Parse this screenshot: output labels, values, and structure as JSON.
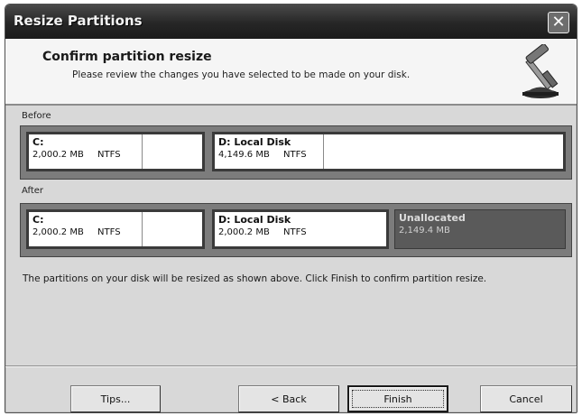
{
  "window": {
    "title": "Resize Partitions",
    "close_glyph": "✕"
  },
  "header": {
    "title": "Confirm partition resize",
    "subtitle": "Please review the changes you have selected to be made on your disk.",
    "icon": "hammer-on-disk-icon"
  },
  "before": {
    "label": "Before",
    "partitions": [
      {
        "name": "C:",
        "size": "2,000.2 MB",
        "fs": "NTFS"
      },
      {
        "name": "D:  Local Disk",
        "size": "4,149.6 MB",
        "fs": "NTFS"
      }
    ]
  },
  "after": {
    "label": "After",
    "partitions": [
      {
        "name": "C:",
        "size": "2,000.2 MB",
        "fs": "NTFS"
      },
      {
        "name": "D:  Local Disk",
        "size": "2,000.2 MB",
        "fs": "NTFS"
      }
    ],
    "unallocated": {
      "name": "Unallocated",
      "size": "2,149.4 MB"
    }
  },
  "message": "The partitions on your disk will be resized as shown above.  Click Finish to confirm partition resize.",
  "buttons": {
    "tips": "Tips...",
    "back": "< Back",
    "finish": "Finish",
    "cancel": "Cancel"
  },
  "colors": {
    "titlebar": "#262626",
    "panel": "#d8d8d8",
    "unallocated": "#5a5a5a"
  }
}
